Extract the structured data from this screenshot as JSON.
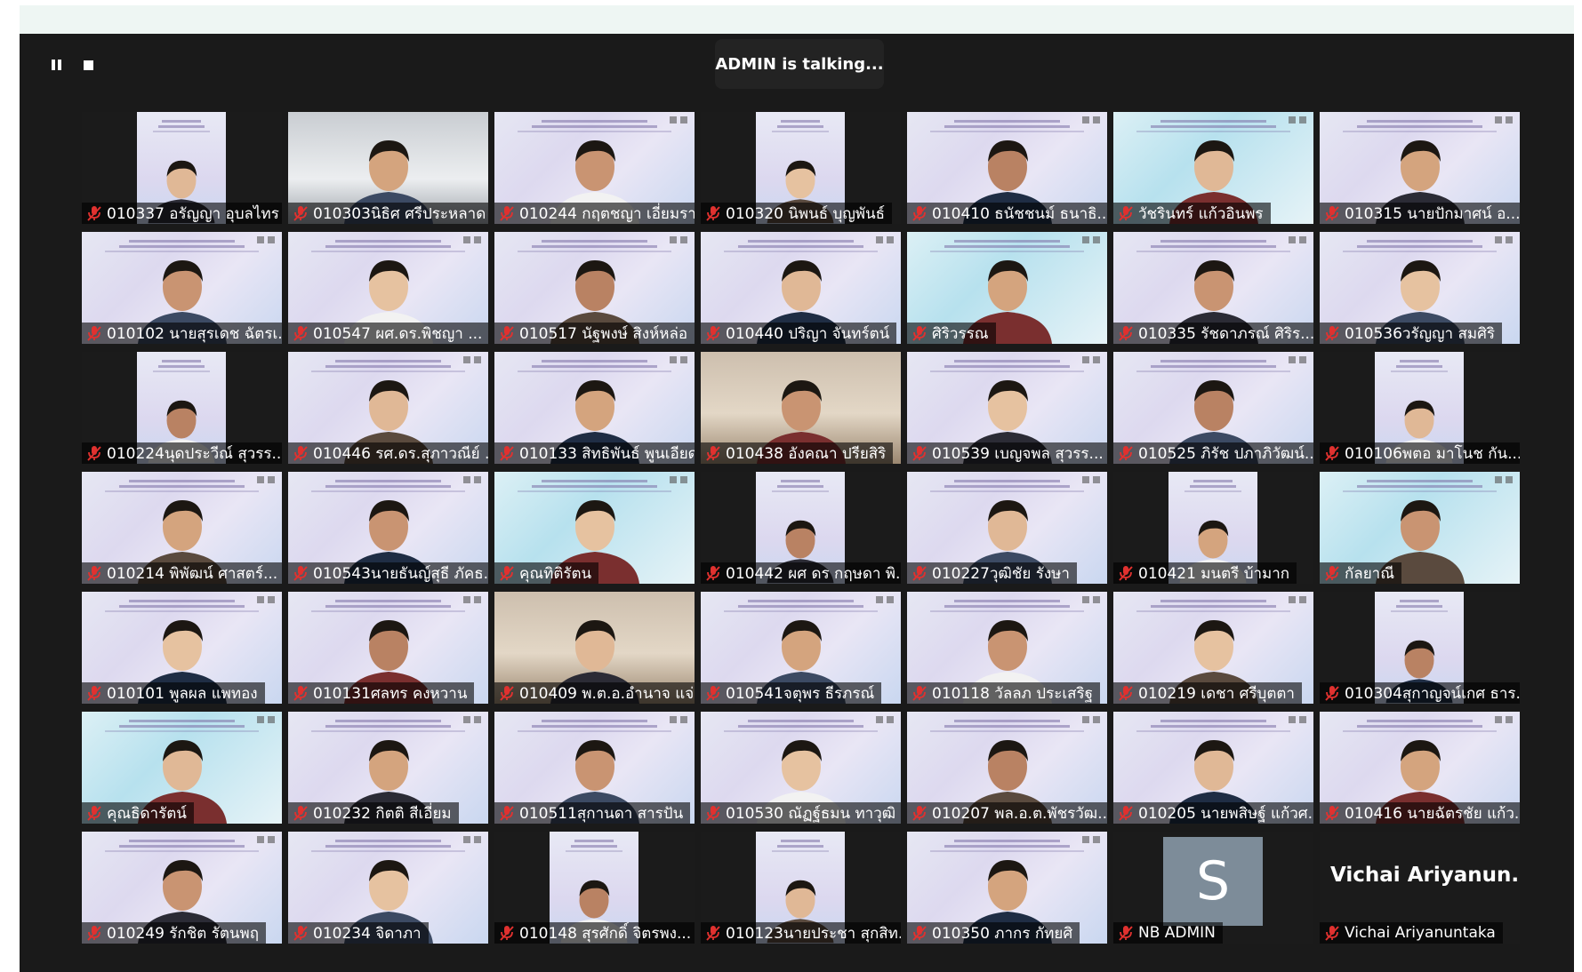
{
  "meeting": {
    "talking_indicator": "ADMIN is talking...",
    "controls": [
      {
        "name": "pause-icon"
      },
      {
        "name": "stop-icon"
      }
    ]
  },
  "colors": {
    "window_background": "#1a1a1a",
    "muted_icon": "#e0312f",
    "avatar_background": "#7d8c99"
  },
  "participants": [
    {
      "name": "010337 อรัญญา อุบลไทร",
      "bg": "dark-inner",
      "muted": true
    },
    {
      "name": "010303นิธิศ ศรีประหลาด",
      "bg": "car",
      "muted": true
    },
    {
      "name": "010244 กฤตชญา เอี่ยมรา...",
      "bg": "slide",
      "muted": true
    },
    {
      "name": "010320 นิพนธ์ บุญพันธ์",
      "bg": "dark-inner",
      "muted": true
    },
    {
      "name": "010410 ธนัชชนม์ ธนาธิ...",
      "bg": "slide",
      "muted": true
    },
    {
      "name": "วัชรินทร์ แก้วอินพร",
      "bg": "cyan",
      "muted": true
    },
    {
      "name": "010315 นายปักมาศน์ อ...",
      "bg": "slide",
      "muted": true
    },
    {
      "name": "010102 นายสุรเดช ฉัตรเ...",
      "bg": "slide",
      "muted": true
    },
    {
      "name": "010547 ผศ.ดร.พิชญา ...",
      "bg": "slide",
      "muted": true
    },
    {
      "name": "010517 นัฐพงษ์ สิงห์หล่อ",
      "bg": "slide",
      "muted": true
    },
    {
      "name": "010440 ปริญา จันทร์ตน์",
      "bg": "slide",
      "muted": true
    },
    {
      "name": "ศิริวรรณ",
      "bg": "cyan",
      "muted": true
    },
    {
      "name": "010335 รัชดาภรณ์ ศิริร...",
      "bg": "slide",
      "muted": true
    },
    {
      "name": "010536วรัญญา สมศิริ",
      "bg": "slide",
      "muted": true
    },
    {
      "name": "010224นุดประวีณ์ สุวรร...",
      "bg": "dark-inner",
      "muted": true
    },
    {
      "name": "010446 รศ.ดร.สุภาวณีย์ ...",
      "bg": "slide",
      "muted": true
    },
    {
      "name": "010133 สิทธิพันธ์ พูนเอียด",
      "bg": "slide",
      "muted": true
    },
    {
      "name": "010438 อังคณา ปรียสิริ",
      "bg": "room",
      "muted": true
    },
    {
      "name": "010539 เบญจพล สุวรร...",
      "bg": "slide",
      "muted": true
    },
    {
      "name": "010525 ภิรัช ปภาภิวัฒน์...",
      "bg": "slide",
      "muted": true
    },
    {
      "name": "010106พตอ มาโนช กัน...",
      "bg": "dark-inner",
      "muted": true
    },
    {
      "name": "010214 พิพัฒน์ ศาสตร์...",
      "bg": "slide",
      "muted": true
    },
    {
      "name": "010543นายธันญ์สุธี ภัคธ...",
      "bg": "slide",
      "muted": true
    },
    {
      "name": "คุณทิติรัตน",
      "bg": "cyan",
      "muted": true
    },
    {
      "name": "010442 ผศ ดร กฤษดา พิ...",
      "bg": "dark-inner",
      "muted": true
    },
    {
      "name": "010227วุฒิชัย รังษา",
      "bg": "slide",
      "muted": true
    },
    {
      "name": "010421 มนตรี บ้ามาก",
      "bg": "dark-inner",
      "muted": true
    },
    {
      "name": "กัลยาณี",
      "bg": "cyan",
      "muted": true
    },
    {
      "name": "010101 พูลผล แพทอง",
      "bg": "slide",
      "muted": true
    },
    {
      "name": "010131ศลทร คงหวาน",
      "bg": "slide",
      "muted": true
    },
    {
      "name": "010409 พ.ต.อ.อำนาจ แจ่...",
      "bg": "room",
      "muted": true
    },
    {
      "name": "010541จตุพร ธีรภรณ์",
      "bg": "slide",
      "muted": true
    },
    {
      "name": "010118 วัลลภ ประเสริฐ",
      "bg": "slide",
      "muted": true
    },
    {
      "name": "010219 เดชา ศรีบุตตา",
      "bg": "slide",
      "muted": true
    },
    {
      "name": "010304สุกาญจน์เกศ ธาร...",
      "bg": "dark-inner",
      "muted": true
    },
    {
      "name": "คุณธิดารัตน์",
      "bg": "cyan",
      "muted": true
    },
    {
      "name": "010232 กิตติ สีเอี่ยม",
      "bg": "slide",
      "muted": true
    },
    {
      "name": "010511สุกานดา สารปัน",
      "bg": "slide",
      "muted": true
    },
    {
      "name": "010530 ณัฏฐ์ธมน ทาวุฒิ",
      "bg": "slide",
      "muted": true
    },
    {
      "name": "010207 พล.อ.ต.พัชรวัฒ...",
      "bg": "slide",
      "muted": true
    },
    {
      "name": "010205 นายพสิษฐ์ แก้วศ...",
      "bg": "slide",
      "muted": true
    },
    {
      "name": "010416 นายฉัตรชัย แก้ว...",
      "bg": "slide",
      "muted": true
    },
    {
      "name": "010249 รักชิต รัตนพฤ",
      "bg": "slide",
      "muted": true
    },
    {
      "name": "010234 จิดาภา",
      "bg": "slide",
      "muted": true
    },
    {
      "name": "010148 สุรศักดิ์ จิตรพง...",
      "bg": "dark-inner",
      "muted": true
    },
    {
      "name": "010123นายประชา สุกสิท...",
      "bg": "dark-inner",
      "muted": true
    },
    {
      "name": "010350 ภากร กัทยศิ",
      "bg": "slide",
      "muted": true
    },
    {
      "name": "NB ADMIN",
      "bg": "avatar",
      "avatar_letter": "S",
      "muted": true
    },
    {
      "name": "Vichai Ariyanuntaka",
      "bg": "namecard",
      "display_name": "Vichai  Ariyanun...",
      "muted": true
    }
  ]
}
